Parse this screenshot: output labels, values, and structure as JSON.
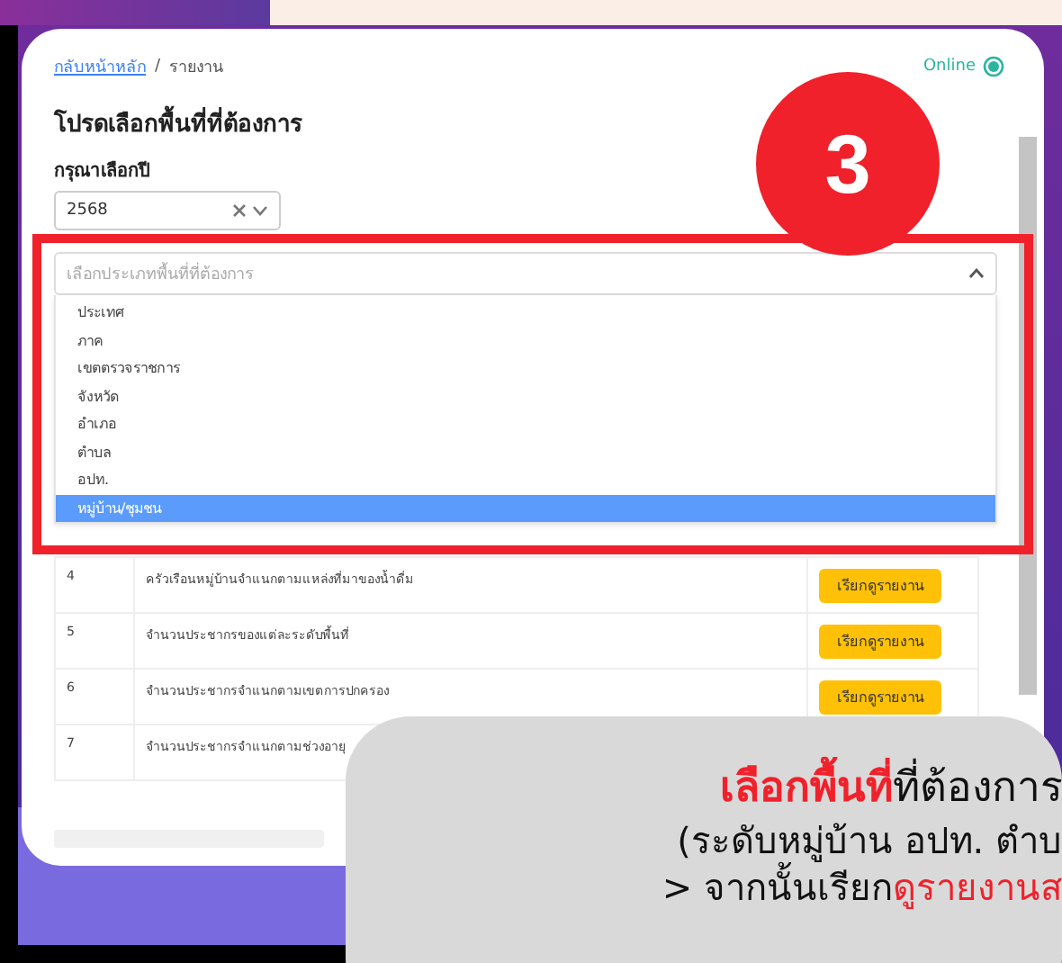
{
  "breadcrumb": {
    "link": "กลับหน้าหลัก",
    "separator": "/",
    "current": "รายงาน"
  },
  "status": {
    "label": "Online",
    "on": true
  },
  "heading": "โปรดเลือกพื้นที่ที่ต้องการ",
  "year_field": {
    "label": "กรุณาเลือกปี",
    "value": "2568"
  },
  "area_type_field": {
    "placeholder": "เลือกประเภทพื้นที่ที่ต้องการ",
    "expanded": true,
    "options": [
      {
        "label": "ประเทศ",
        "selected": false
      },
      {
        "label": "ภาค",
        "selected": false
      },
      {
        "label": "เขตตรวจราชการ",
        "selected": false
      },
      {
        "label": "จังหวัด",
        "selected": false
      },
      {
        "label": "อำเภอ",
        "selected": false
      },
      {
        "label": "ตำบล",
        "selected": false
      },
      {
        "label": "อปท.",
        "selected": false
      },
      {
        "label": "หมู่บ้าน/ชุมชน",
        "selected": true
      }
    ]
  },
  "table": {
    "rows": [
      {
        "number": "4",
        "title": "ครัวเรือนหมู่บ้านจำแนกตามแหล่งที่มาของน้ำดื่ม",
        "button": "เรียกดูรายงาน"
      },
      {
        "number": "5",
        "title": "จำนวนประชากรของแต่ละระดับพื้นที่",
        "button": "เรียกดูรายงาน"
      },
      {
        "number": "6",
        "title": "จำนวนประชากรจำแนกตามเขตการปกครอง",
        "button": "เรียกดูรายงาน"
      },
      {
        "number": "7",
        "title": "จำนวนประชากรจำแนกตามช่วงอายุ"
      }
    ]
  },
  "step_badge": "3",
  "callout": {
    "lines": [
      [
        {
          "text": "เลือกพื้นที่",
          "accent": true
        },
        {
          "text": "ที่ต้องการ",
          "accent": false
        }
      ],
      [
        {
          "text": "(ระดับหมู่บ้าน อปท. ตำบ",
          "accent": false
        }
      ],
      [
        {
          "text": "> จากนั้นเรียก",
          "accent": false
        },
        {
          "text": "ดูรายงานส",
          "accent": true
        }
      ]
    ]
  }
}
